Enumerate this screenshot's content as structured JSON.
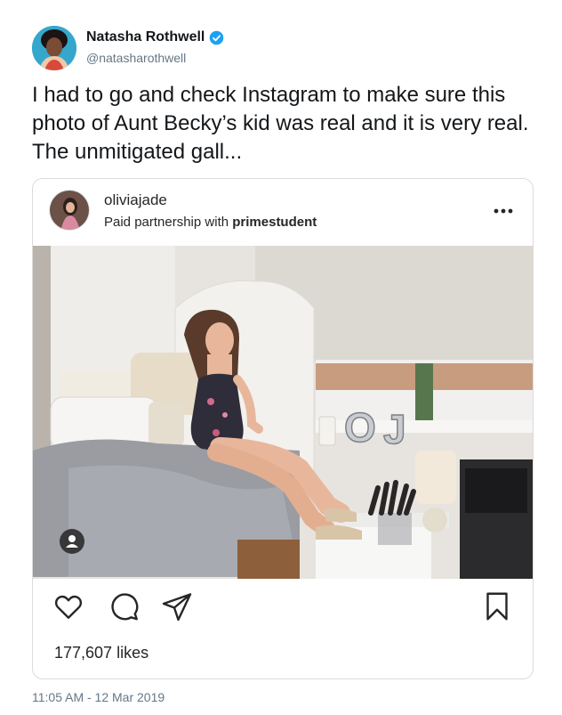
{
  "tweet": {
    "author_name": "Natasha Rothwell",
    "handle": "@natasharothwell",
    "text": "I had to go and check Instagram to make sure this photo of Aunt Becky’s kid was real and it is very real. The unmitigated gall...",
    "timestamp": "11:05 AM - 12 Mar 2019",
    "verified_icon": "verified-badge-icon",
    "accent_color": "#1da1f2"
  },
  "instagram_embed": {
    "username": "oliviajade",
    "partnership_prefix": "Paid partnership with",
    "partner": "primestudent",
    "likes": "177,607 likes",
    "icons": [
      "more-options-icon",
      "heart-icon",
      "comment-icon",
      "share-icon",
      "bookmark-icon",
      "user-tag-icon"
    ],
    "photo_letters": [
      "O",
      "J"
    ]
  }
}
